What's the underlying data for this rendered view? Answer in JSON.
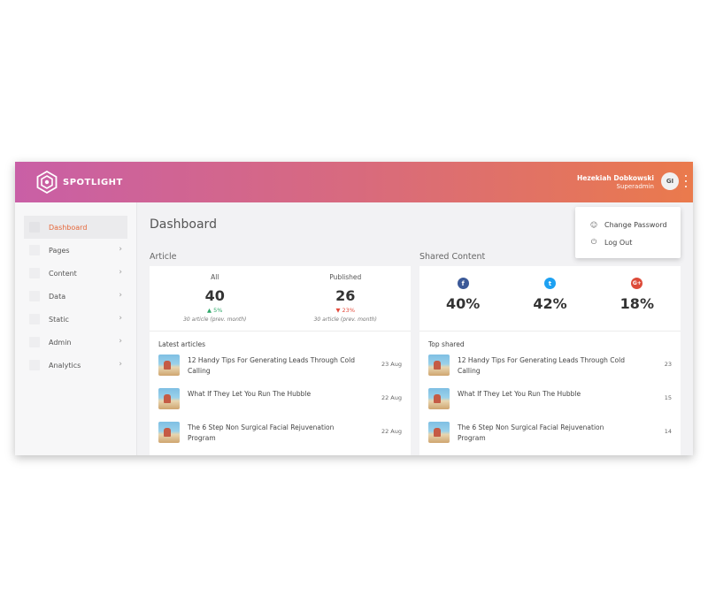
{
  "app": {
    "brand": "SPOTLIGHT"
  },
  "user": {
    "name": "Hezekiah Dobkowski",
    "role": "Superadmin",
    "initials": "GI"
  },
  "dropdown": {
    "items": [
      {
        "label": "Change Password",
        "icon": "user-key-icon"
      },
      {
        "label": "Log Out",
        "icon": "power-icon"
      }
    ]
  },
  "sidebar": {
    "items": [
      {
        "label": "Dashboard",
        "active": true
      },
      {
        "label": "Pages"
      },
      {
        "label": "Content"
      },
      {
        "label": "Data"
      },
      {
        "label": "Static"
      },
      {
        "label": "Admin"
      },
      {
        "label": "Analytics"
      }
    ],
    "chevron": "›"
  },
  "page": {
    "title": "Dashboard"
  },
  "article": {
    "section_title": "Article",
    "stats": [
      {
        "label": "All",
        "value": "40",
        "change": "▲ 5%",
        "direction": "up",
        "prev": "30 article (prev. month)"
      },
      {
        "label": "Published",
        "value": "26",
        "change": "▼ 23%",
        "direction": "down",
        "prev": "30 article (prev. month)"
      }
    ],
    "list_title": "Latest articles",
    "items": [
      {
        "title": "12 Handy Tips For Generating Leads Through Cold Calling",
        "meta": "23 Aug"
      },
      {
        "title": "What If They Let You Run The Hubble",
        "meta": "22 Aug"
      },
      {
        "title": "The 6 Step Non Surgical Facial Rejuvenation Program",
        "meta": "22 Aug"
      }
    ]
  },
  "shared": {
    "section_title": "Shared Content",
    "networks": [
      {
        "icon": "facebook-icon",
        "glyph": "f",
        "color": "#3b5998",
        "percent": "40%"
      },
      {
        "icon": "twitter-icon",
        "glyph": "t",
        "color": "#1da1f2",
        "percent": "42%"
      },
      {
        "icon": "google-plus-icon",
        "glyph": "G+",
        "color": "#dd4b39",
        "percent": "18%"
      }
    ],
    "list_title": "Top shared",
    "items": [
      {
        "title": "12 Handy Tips For Generating Leads Through Cold Calling",
        "meta": "23"
      },
      {
        "title": "What If They Let You Run The Hubble",
        "meta": "15"
      },
      {
        "title": "The 6 Step Non Surgical Facial Rejuvenation Program",
        "meta": "14"
      }
    ]
  }
}
